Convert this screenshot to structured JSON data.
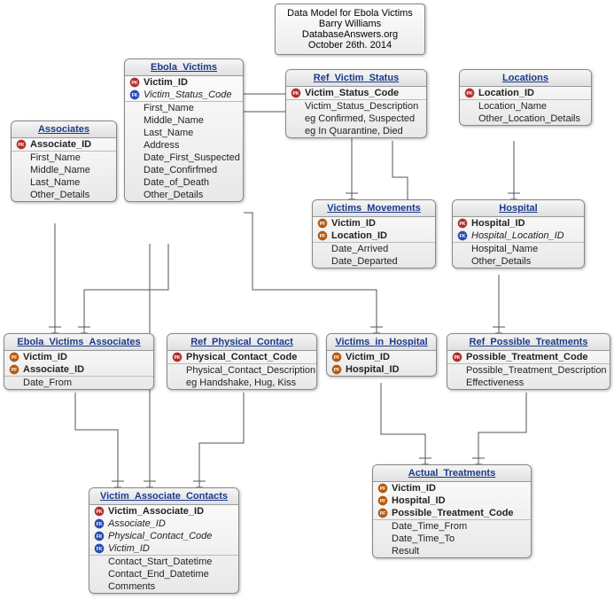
{
  "info": {
    "line1": "Data Model for Ebola Victims",
    "line2": "Barry Williams",
    "line3": "DatabaseAnswers.org",
    "line4": "October 26th. 2014"
  },
  "entities": {
    "associates": {
      "title": "Associates",
      "attrs": [
        {
          "name": "Associate_ID",
          "key": "pk",
          "bold": true
        },
        {
          "name": "First_Name"
        },
        {
          "name": "Middle_Name"
        },
        {
          "name": "Last_Name"
        },
        {
          "name": "Other_Details"
        }
      ]
    },
    "ebola_victims": {
      "title": "Ebola_Victims",
      "attrs": [
        {
          "name": "Victim_ID",
          "key": "pk",
          "bold": true
        },
        {
          "name": "Victim_Status_Code",
          "key": "fk",
          "italic": true
        },
        {
          "name": "First_Name"
        },
        {
          "name": "Middle_Name"
        },
        {
          "name": "Last_Name"
        },
        {
          "name": "Address"
        },
        {
          "name": "Date_First_Suspected"
        },
        {
          "name": "Date_Confirfmed"
        },
        {
          "name": "Date_of_Death"
        },
        {
          "name": "Other_Details"
        }
      ]
    },
    "ref_victim_status": {
      "title": "Ref_Victim_Status",
      "attrs": [
        {
          "name": "Victim_Status_Code",
          "key": "pk",
          "bold": true
        },
        {
          "name": "Victim_Status_Description"
        },
        {
          "name": "eg Confirmed, Suspected"
        },
        {
          "name": "eg In Quarantine, Died"
        }
      ]
    },
    "locations": {
      "title": "Locations",
      "attrs": [
        {
          "name": "Location_ID",
          "key": "pk",
          "bold": true
        },
        {
          "name": "Location_Name"
        },
        {
          "name": "Other_Location_Details"
        }
      ]
    },
    "victims_movements": {
      "title": "Victims_Movements",
      "attrs": [
        {
          "name": "Victim_ID",
          "key": "pf",
          "bold": true
        },
        {
          "name": "Location_ID",
          "key": "pf",
          "bold": true
        },
        {
          "name": "Date_Arrived"
        },
        {
          "name": "Date_Departed"
        }
      ]
    },
    "hospital": {
      "title": "Hospital",
      "attrs": [
        {
          "name": "Hospital_ID",
          "key": "pk",
          "bold": true
        },
        {
          "name": "Hospital_Location_ID",
          "key": "fk",
          "italic": true
        },
        {
          "name": "Hospital_Name"
        },
        {
          "name": "Other_Details"
        }
      ]
    },
    "eva": {
      "title": "Ebola_Victims_Associates",
      "attrs": [
        {
          "name": "Victim_ID",
          "key": "pf",
          "bold": true
        },
        {
          "name": "Associate_ID",
          "key": "pf",
          "bold": true
        },
        {
          "name": "Date_From"
        }
      ]
    },
    "ref_physical_contact": {
      "title": "Ref_Physical_Contact",
      "attrs": [
        {
          "name": "Physical_Contact_Code",
          "key": "pk",
          "bold": true
        },
        {
          "name": "Physical_Contact_Description"
        },
        {
          "name": "eg Handshake, Hug, Kiss"
        }
      ]
    },
    "victims_in_hospital": {
      "title": "Victims_in_Hospital",
      "attrs": [
        {
          "name": "Victim_ID",
          "key": "pf",
          "bold": true
        },
        {
          "name": "Hospital_ID",
          "key": "pf",
          "bold": true
        }
      ]
    },
    "ref_possible_treatments": {
      "title": "Ref_Possible_Treatments",
      "attrs": [
        {
          "name": "Possible_Treatment_Code",
          "key": "pk",
          "bold": true
        },
        {
          "name": "Possible_Treatment_Description"
        },
        {
          "name": "Effectiveness"
        }
      ]
    },
    "victim_associate_contacts": {
      "title": "Victim_Associate_Contacts",
      "attrs": [
        {
          "name": "Victim_Associate_ID",
          "key": "pk",
          "bold": true
        },
        {
          "name": "Associate_ID",
          "key": "fk",
          "italic": true
        },
        {
          "name": "Physical_Contact_Code",
          "key": "fk",
          "italic": true
        },
        {
          "name": "Victim_ID",
          "key": "fk",
          "italic": true
        },
        {
          "name": "Contact_Start_Datetime"
        },
        {
          "name": "Contact_End_Datetime"
        },
        {
          "name": "Comments"
        }
      ]
    },
    "actual_treatments": {
      "title": "Actual_Treatments",
      "attrs": [
        {
          "name": "Victim_ID",
          "key": "pf",
          "bold": true
        },
        {
          "name": "Hospital_ID",
          "key": "pf",
          "bold": true
        },
        {
          "name": "Possible_Treatment_Code",
          "key": "pf",
          "bold": true
        },
        {
          "name": "Date_Time_From"
        },
        {
          "name": "Date_Time_To"
        },
        {
          "name": "Result"
        }
      ]
    }
  }
}
